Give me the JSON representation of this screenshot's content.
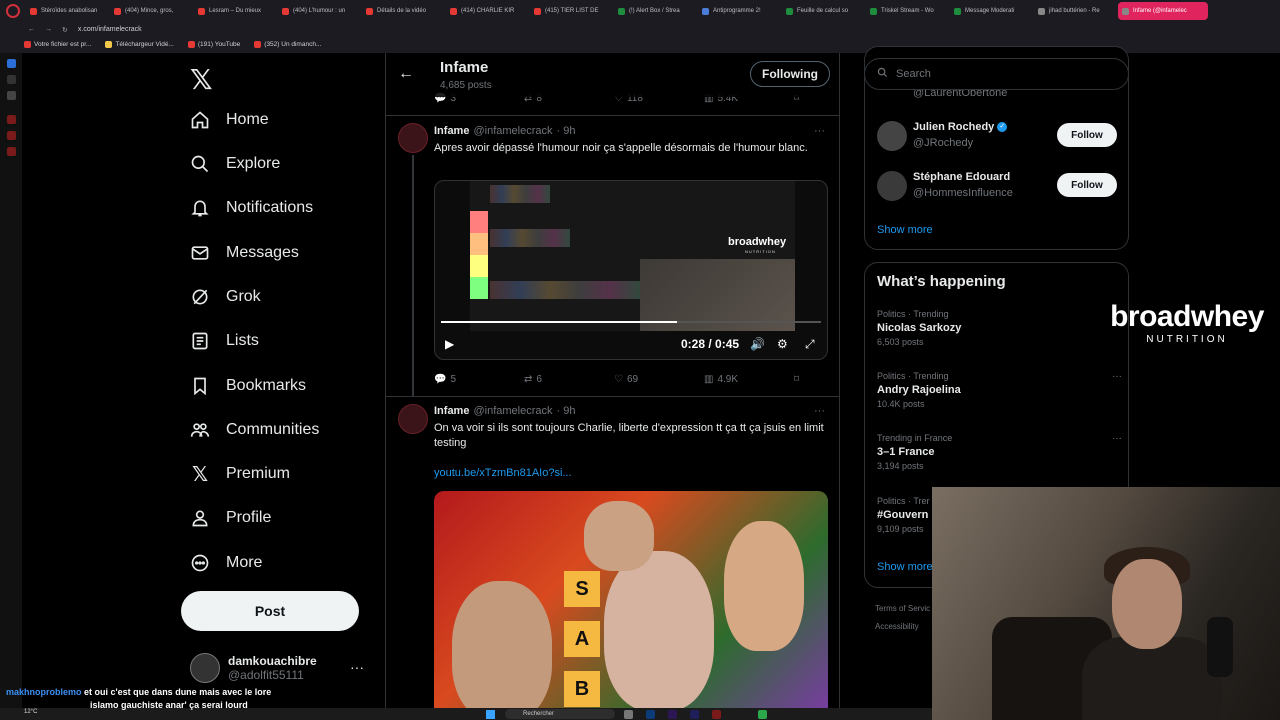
{
  "browser": {
    "tabs": [
      {
        "label": "Stéroïdes anabolisan",
        "fav": "red"
      },
      {
        "label": "(404) Mince, gros, ",
        "fav": "red"
      },
      {
        "label": "Lesram – Du mieux",
        "fav": "red"
      },
      {
        "label": "(404) L'humour : un",
        "fav": "red"
      },
      {
        "label": "Détails de la vidéo",
        "fav": "red"
      },
      {
        "label": "(414) CHARLIE KIR",
        "fav": "red"
      },
      {
        "label": "(415) TIER LIST DE",
        "fav": "red"
      },
      {
        "label": "(!) Alert Box / Strea",
        "fav": "green"
      },
      {
        "label": "Antiprogramme 2!",
        "fav": "blue"
      },
      {
        "label": "Feuille de calcul so",
        "fav": "green"
      },
      {
        "label": "Triskel Stream - Wo",
        "fav": "green"
      },
      {
        "label": "Message Moderati",
        "fav": "green"
      },
      {
        "label": "jihad buttérien - Re",
        "fav": "grey"
      },
      {
        "label": "Infame (@infamelec",
        "fav": "grey",
        "active": true
      }
    ],
    "url": "x.com/infamelecrack",
    "bookmarks": [
      "Votre fichier est pr...",
      "Téléchargeur Vidé...",
      "(191) YouTube",
      "(352) Un dimanch..."
    ]
  },
  "nav": {
    "logo": "𝕏",
    "items": [
      {
        "label": "Home",
        "icon": "home-icon"
      },
      {
        "label": "Explore",
        "icon": "search-icon"
      },
      {
        "label": "Notifications",
        "icon": "bell-icon"
      },
      {
        "label": "Messages",
        "icon": "envelope-icon"
      },
      {
        "label": "Grok",
        "icon": "grok-icon"
      },
      {
        "label": "Lists",
        "icon": "list-icon"
      },
      {
        "label": "Bookmarks",
        "icon": "bookmark-icon"
      },
      {
        "label": "Communities",
        "icon": "people-icon"
      },
      {
        "label": "Premium",
        "icon": "x-icon"
      },
      {
        "label": "Profile",
        "icon": "person-icon"
      },
      {
        "label": "More",
        "icon": "more-circle-icon"
      }
    ],
    "post_label": "Post",
    "account": {
      "name": "damkouachibre",
      "handle": "@adolfit55111",
      "more": "···"
    }
  },
  "timeline": {
    "header": {
      "name": "Infame",
      "posts": "4,685 posts",
      "following_label": "Following"
    },
    "top_actions": {
      "replies": "3",
      "reposts": "8",
      "likes": "118",
      "views": "5.4K"
    },
    "tweets": [
      {
        "name": "Infame",
        "handle": "@infamelecrack",
        "time": "· 9h",
        "text": "Apres avoir dépassé l'humour noir ça s'appelle désormais de l'humour blanc.",
        "video": {
          "time": "0:28 / 0:45",
          "progress": 0.62,
          "brand": "broadwhey",
          "brand_sub": "NUTRITION"
        },
        "actions": {
          "replies": "5",
          "reposts": "6",
          "likes": "69",
          "views": "4.9K"
        }
      },
      {
        "name": "Infame",
        "handle": "@infamelecrack",
        "time": "· 9h",
        "text": "On va voir si ils sont toujours Charlie, liberte d'expression tt ça tt ça jsuis en limit testing",
        "link": "youtu.be/xTzmBn81AIo?si...",
        "tier_letters": [
          "S",
          "A",
          "B"
        ]
      }
    ]
  },
  "right": {
    "search_placeholder": "Search",
    "who_to_follow": [
      {
        "name": "Julien Rochedy",
        "handle": "@JRochedy",
        "verified": true,
        "follow_label": "Follow"
      },
      {
        "name": "Stéphane Edouard",
        "handle": "@HommesInfluence",
        "verified": false,
        "follow_label": "Follow"
      }
    ],
    "partial_handle": "@LaurentObertone",
    "show_more": "Show more",
    "whats_happening": {
      "title": "What’s happening",
      "trends": [
        {
          "meta": "Politics · Trending",
          "name": "Nicolas Sarkozy",
          "count": "6,503 posts"
        },
        {
          "meta": "Politics · Trending",
          "name": "Andry Rajoelina",
          "count": "10.4K posts"
        },
        {
          "meta": "Trending in France",
          "name": "3–1 France",
          "count": "3,194 posts"
        },
        {
          "meta": "Politics · Trer",
          "name": "#Gouvern",
          "count": "9,109 posts"
        }
      ],
      "show_more": "Show more"
    },
    "footer": [
      "Terms of Servic",
      "Accessibility"
    ]
  },
  "stream": {
    "brand": "broadwhey",
    "brand_sub": "NUTRITION",
    "chat": {
      "user": "makhnoproblemo",
      "message_line1": "et oui c'est que dans dune mais avec le lore",
      "message_line2": "islamo gauchiste anar' ça serai lourd"
    },
    "taskbar": {
      "weather": "12°C",
      "search": "Rechercher"
    }
  },
  "colors": {
    "accent": "#1d9bf0",
    "background": "#000000",
    "border": "#2f3336",
    "muted": "#71767b"
  }
}
